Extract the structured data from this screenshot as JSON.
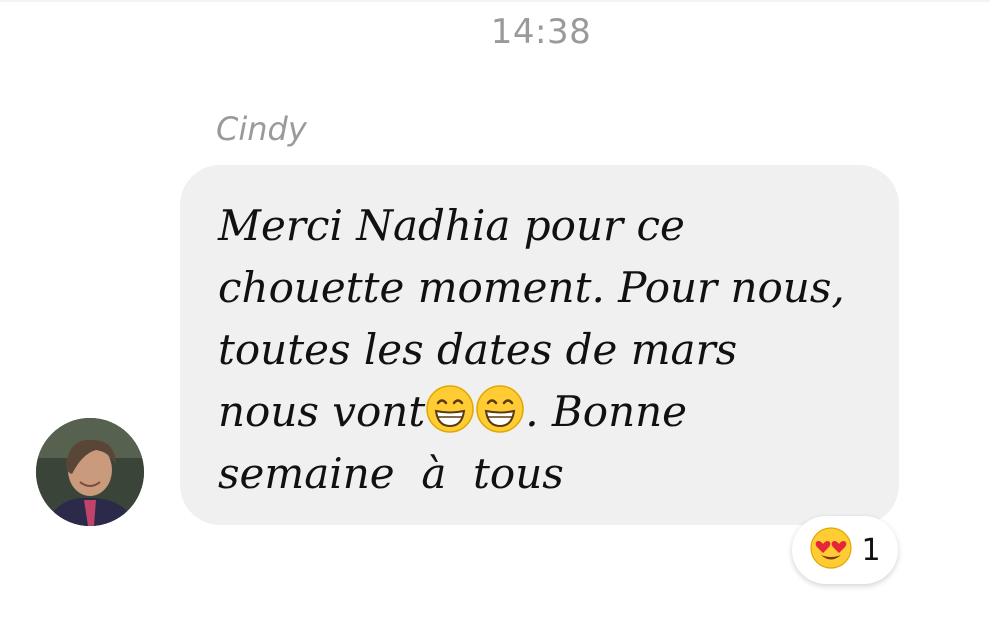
{
  "conversation": {
    "timestamp": "14:38"
  },
  "message": {
    "sender": "Cindy",
    "text_part1": "Merci Nadhia pour ce\nchouette moment. Pour nous,\ntoutes les dates de mars\nnous vont",
    "text_part2": ". Bonne\nsemaine  à  tous",
    "inline_emojis": [
      "grinning-face-with-smiling-eyes",
      "grinning-face-with-smiling-eyes"
    ]
  },
  "reaction": {
    "emoji": "smiling-face-with-heart-eyes",
    "count": "1"
  },
  "colors": {
    "bubble": "#f0f0f0",
    "text": "#111111",
    "muted": "#9a9a9a"
  }
}
